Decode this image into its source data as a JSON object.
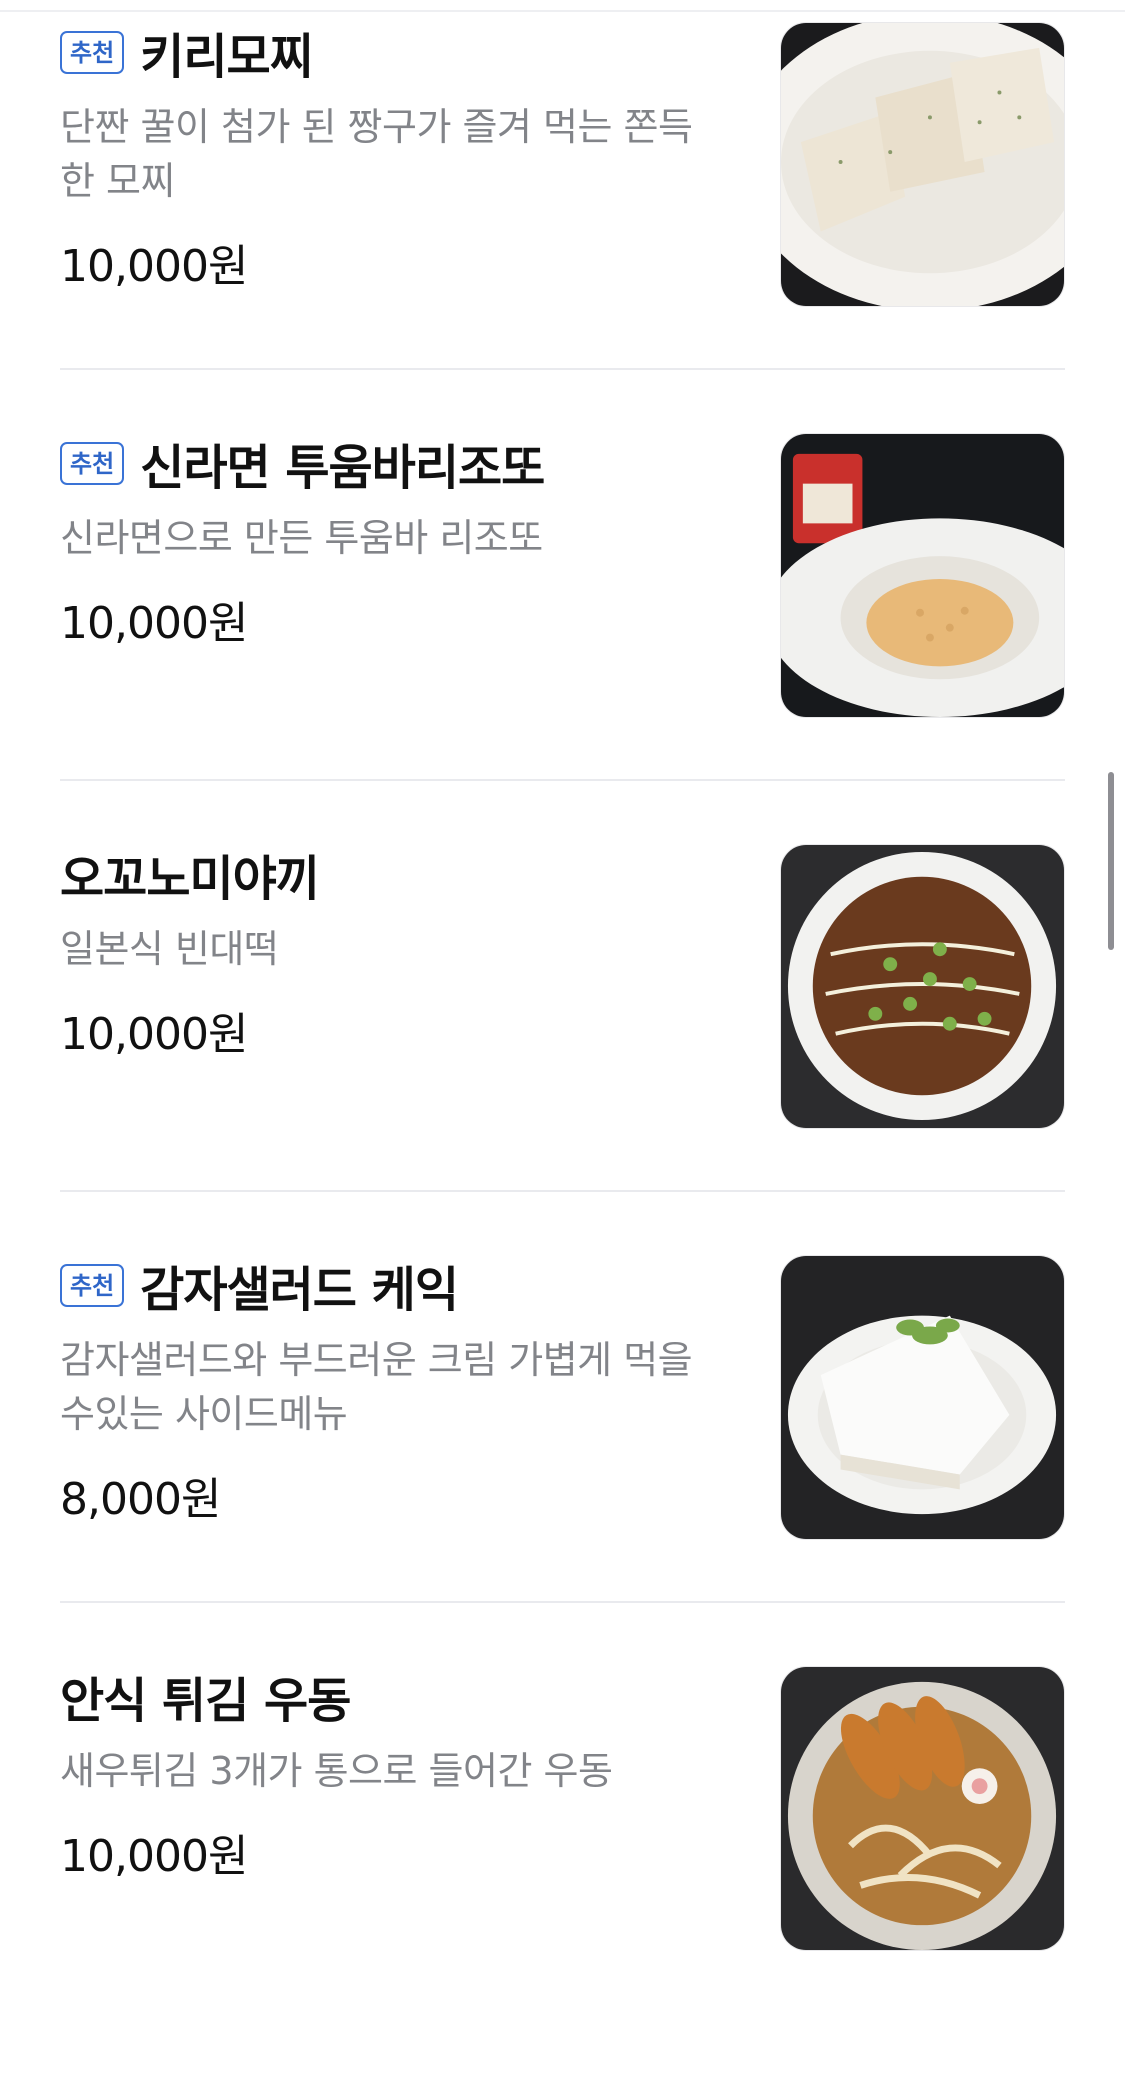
{
  "items": [
    {
      "badge": "추천",
      "title": "키리모찌",
      "description": "단짠 꿀이 첨가 된 짱구가 즐겨 먹는 쫀득한 모찌",
      "price": "10,000원",
      "photo_icon": "mochi-photo"
    },
    {
      "badge": "추천",
      "title": "신라면 투움바리조또",
      "description": "신라면으로 만든 투움바 리조또",
      "price": "10,000원",
      "photo_icon": "risotto-photo"
    },
    {
      "badge": "",
      "title": "오꼬노미야끼",
      "description": "일본식 빈대떡",
      "price": "10,000원",
      "photo_icon": "okonomiyaki-photo"
    },
    {
      "badge": "추천",
      "title": "감자샐러드 케익",
      "description": "감자샐러드와 부드러운 크림 가볍게 먹을수있는 사이드메뉴",
      "price": "8,000원",
      "photo_icon": "cake-photo"
    },
    {
      "badge": "",
      "title": "안식 튀김 우동",
      "description": "새우튀김 3개가 통으로 들어간 우동",
      "price": "10,000원",
      "photo_icon": "udon-photo"
    }
  ],
  "colors": {
    "badge": "#2f66c8",
    "description": "#828489",
    "divider": "#e9eaee"
  }
}
